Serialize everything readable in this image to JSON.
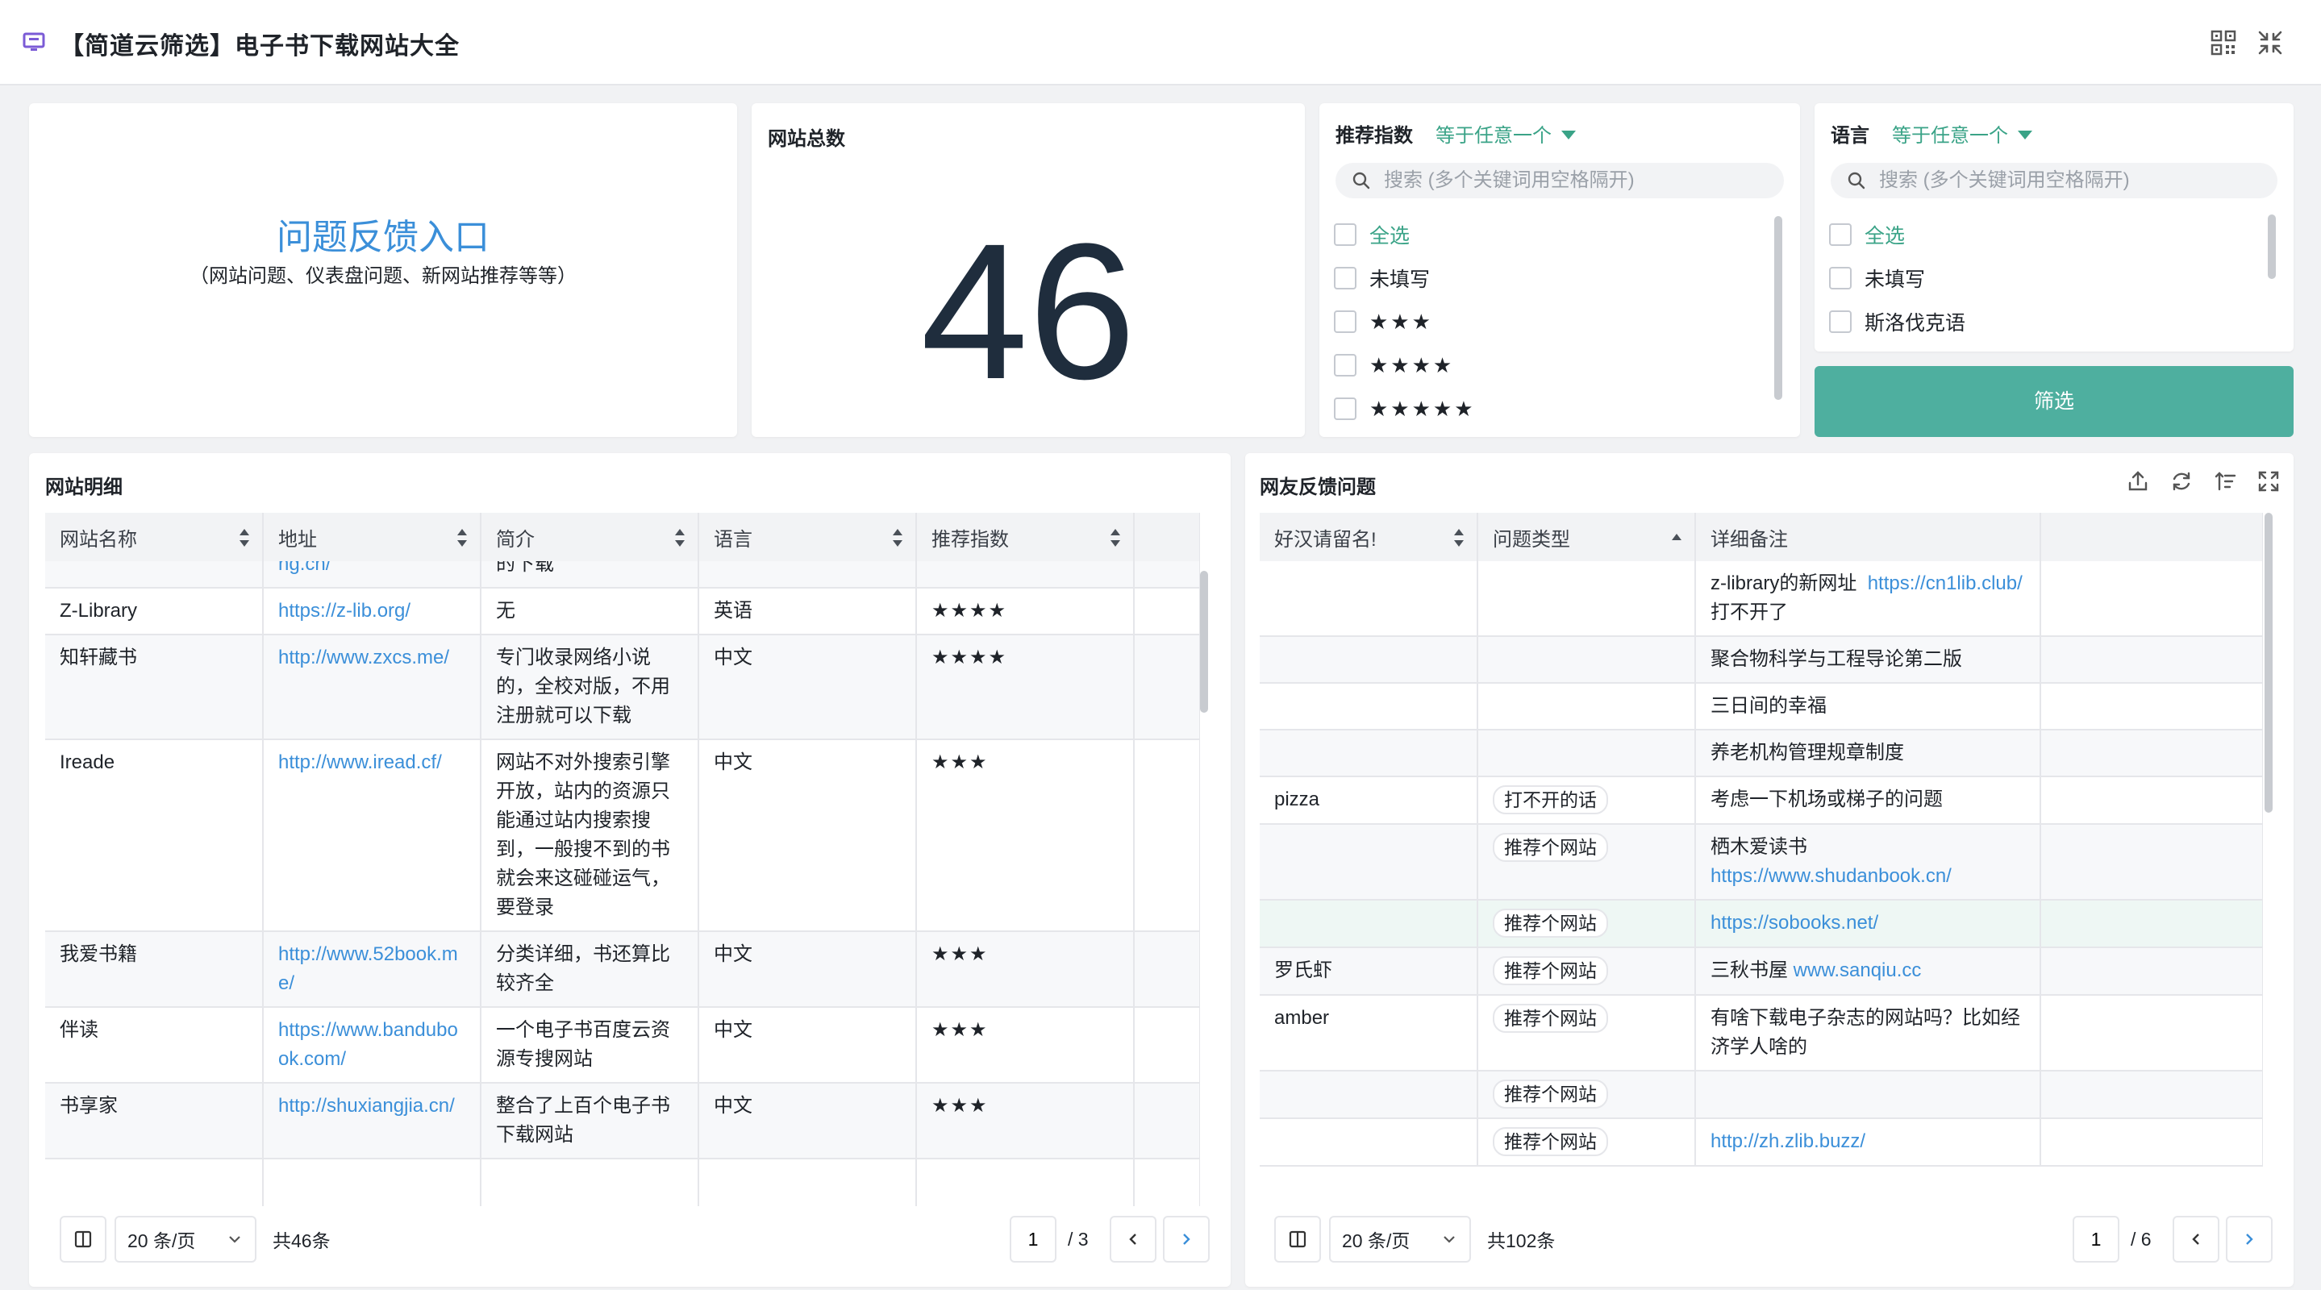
{
  "header": {
    "title": "【简道云筛选】电子书下载网站大全",
    "app_icon": "dashboard-icon",
    "actions": [
      "qrcode-icon",
      "collapse-icon"
    ]
  },
  "feedback_card": {
    "link_text": "问题反馈入口",
    "subtitle": "（网站问题、仪表盘问题、新网站推荐等等）"
  },
  "total_card": {
    "title": "网站总数",
    "value": "46"
  },
  "filter_rating": {
    "label": "推荐指数",
    "operator": "等于任意一个",
    "search_placeholder": "搜索 (多个关键词用空格隔开)",
    "options": [
      "全选",
      "未填写",
      "★★★",
      "★★★★",
      "★★★★★"
    ]
  },
  "filter_language": {
    "label": "语言",
    "operator": "等于任意一个",
    "search_placeholder": "搜索 (多个关键词用空格隔开)",
    "options": [
      "全选",
      "未填写",
      "斯洛伐克语"
    ],
    "button_label": "筛选"
  },
  "sites": {
    "title": "网站明细",
    "columns": [
      "网站名称",
      "地址",
      "简介",
      "语言",
      "推荐指数"
    ],
    "rows": [
      {
        "name": "",
        "url": "ng.cn/",
        "desc": "的下载",
        "lang": "",
        "rating": ""
      },
      {
        "name": "Z-Library",
        "url": "https://z-lib.org/",
        "desc": "无",
        "lang": "英语",
        "rating": "★★★★"
      },
      {
        "name": "知轩藏书",
        "url": "http://www.zxcs.me/",
        "desc": "专门收录网络小说的，全校对版，不用注册就可以下载",
        "lang": "中文",
        "rating": "★★★★"
      },
      {
        "name": "Ireade",
        "url": "http://www.iread.cf/",
        "desc": "网站不对外搜索引擎开放，站内的资源只能通过站内搜索搜到，一般搜不到的书就会来这碰碰运气，要登录",
        "lang": "中文",
        "rating": "★★★"
      },
      {
        "name": "我爱书籍",
        "url": "http://www.52book.me/",
        "desc": "分类详细，书还算比较齐全",
        "lang": "中文",
        "rating": "★★★"
      },
      {
        "name": "伴读",
        "url": "https://www.bandubook.com/",
        "desc": "一个电子书百度云资源专搜网站",
        "lang": "中文",
        "rating": "★★★"
      },
      {
        "name": "书享家",
        "url": "http://shuxiangjia.cn/",
        "desc": "整合了上百个电子书下载网站",
        "lang": "中文",
        "rating": "★★★"
      },
      {
        "name": "",
        "url": "",
        "desc": "",
        "lang": "",
        "rating": ""
      }
    ],
    "pager": {
      "page_size": "20 条/页",
      "total": "共46条",
      "current": "1",
      "pages": "/ 3"
    }
  },
  "feedback": {
    "title": "网友反馈问题",
    "columns": [
      "好汉请留名!",
      "问题类型",
      "详细备注"
    ],
    "toolbar_icons": [
      "export-icon",
      "refresh-icon",
      "sort-icon",
      "fullscreen-icon"
    ],
    "rows": [
      {
        "name": "",
        "type": "",
        "note": "z-library的新网址",
        "link": "https://cn1lib.club/",
        "note2": "打不开了"
      },
      {
        "name": "",
        "type": "",
        "note": "聚合物科学与工程导论第二版",
        "link": "",
        "note2": ""
      },
      {
        "name": "",
        "type": "",
        "note": "三日间的幸福",
        "link": "",
        "note2": ""
      },
      {
        "name": "",
        "type": "",
        "note": "养老机构管理规章制度",
        "link": "",
        "note2": ""
      },
      {
        "name": "pizza",
        "type": "打不开的话",
        "note": "考虑一下机场或梯子的问题",
        "link": "",
        "note2": ""
      },
      {
        "name": "",
        "type": "推荐个网站",
        "note": "栖木爱读书",
        "link": "https://www.shudanbook.cn/",
        "note2": ""
      },
      {
        "name": "",
        "type": "推荐个网站",
        "note": "",
        "link": "https://sobooks.net/",
        "note2": ""
      },
      {
        "name": "罗氏虾",
        "type": "推荐个网站",
        "note": "三秋书屋",
        "link": "www.sanqiu.cc",
        "note2": ""
      },
      {
        "name": "amber",
        "type": "推荐个网站",
        "note": "有啥下载电子杂志的网站吗？比如经济学人啥的",
        "link": "",
        "note2": ""
      },
      {
        "name": "",
        "type": "推荐个网站",
        "note": "",
        "link": "",
        "note2": ""
      },
      {
        "name": "",
        "type": "推荐个网站",
        "note": "",
        "link": "http://zh.zlib.buzz/",
        "note2": ""
      }
    ],
    "pager": {
      "page_size": "20 条/页",
      "total": "共102条",
      "current": "1",
      "pages": "/ 6"
    }
  }
}
